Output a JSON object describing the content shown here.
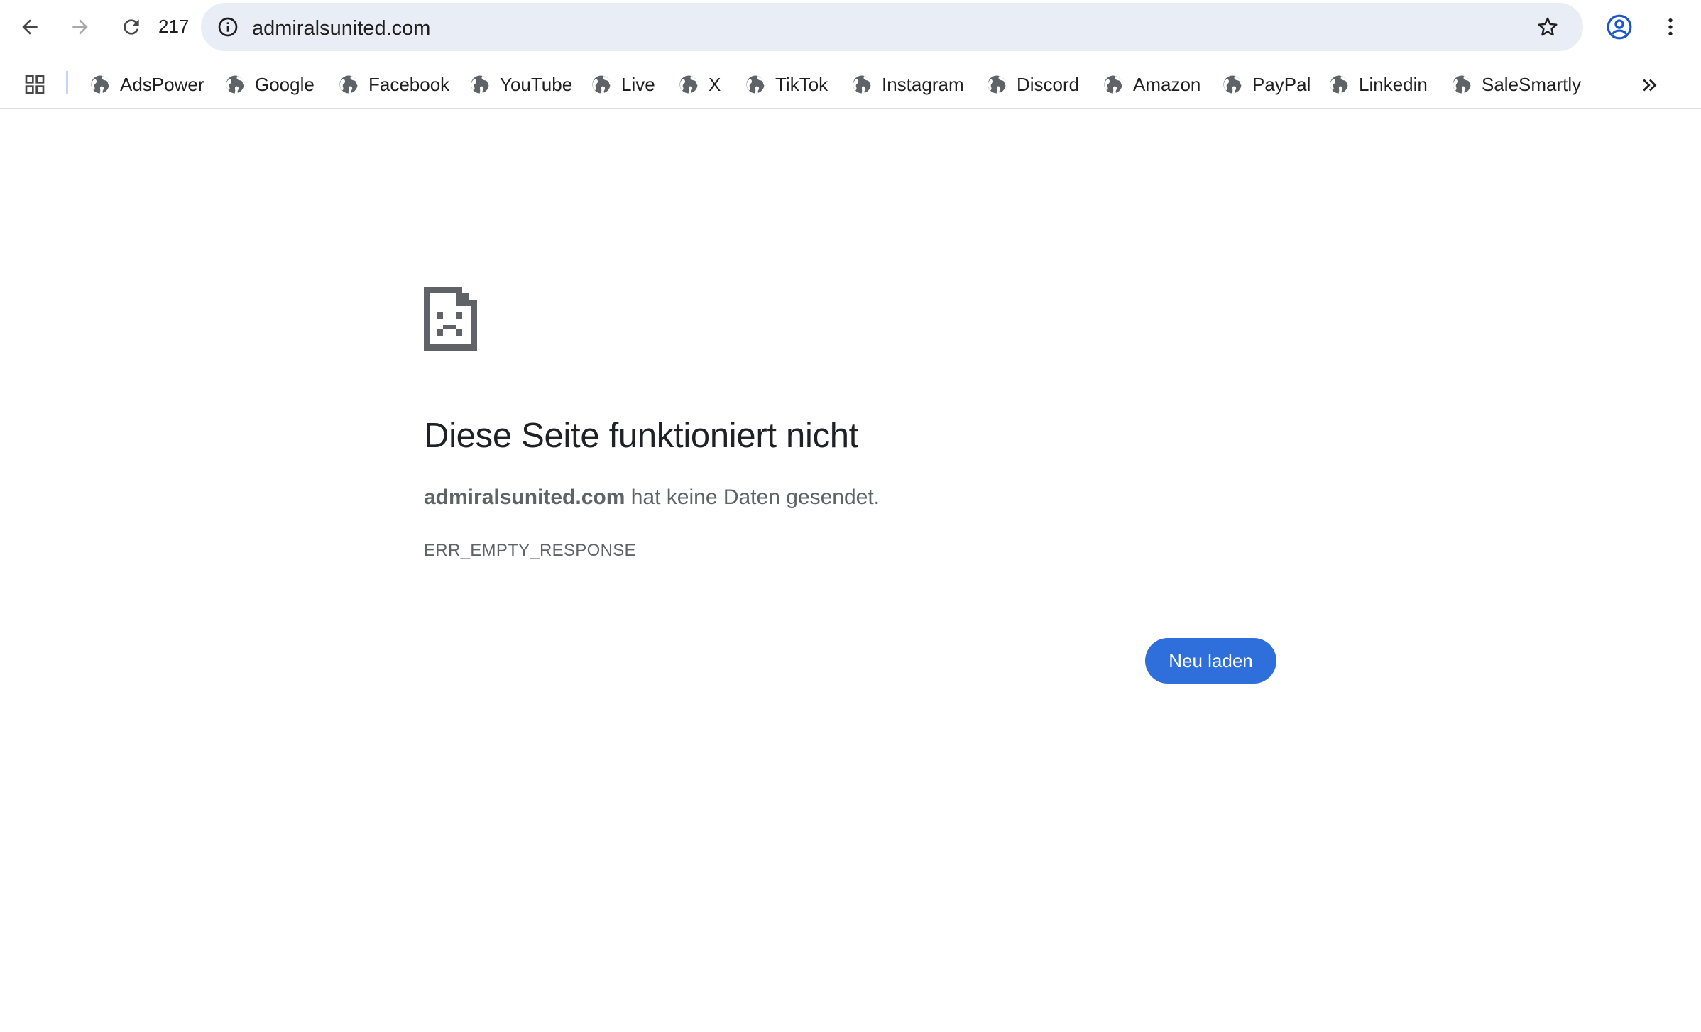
{
  "toolbar": {
    "back_icon": "arrow-left-icon",
    "forward_icon": "arrow-right-icon",
    "reload_icon": "reload-icon",
    "reload_count": "217",
    "url": "admiralsunited.com",
    "info_icon": "info-icon",
    "bookmark_star_icon": "star-icon",
    "profile_icon": "account-circle-icon",
    "menu_icon": "kebab-menu-icon"
  },
  "bookmarks": {
    "apps_icon": "apps-grid-icon",
    "items": [
      {
        "label": "AdsPower"
      },
      {
        "label": "Google"
      },
      {
        "label": "Facebook"
      },
      {
        "label": "YouTube"
      },
      {
        "label": "Live"
      },
      {
        "label": "X"
      },
      {
        "label": "TikTok"
      },
      {
        "label": "Instagram"
      },
      {
        "label": "Discord"
      },
      {
        "label": "Amazon"
      },
      {
        "label": "PayPal"
      },
      {
        "label": "Linkedin"
      },
      {
        "label": "SaleSmartly"
      }
    ],
    "more_icon": "double-chevron-right-icon"
  },
  "error": {
    "icon": "sad-document-icon",
    "title": "Diese Seite funktioniert nicht",
    "host": "admiralsunited.com",
    "message_suffix": " hat keine Daten gesendet.",
    "code": "ERR_EMPTY_RESPONSE",
    "reload_label": "Neu laden"
  },
  "colors": {
    "accent": "#2f6fdc",
    "omnibox_bg": "#e9eef6",
    "text_secondary": "#5f6368",
    "profile_blue": "#1a56c9"
  }
}
